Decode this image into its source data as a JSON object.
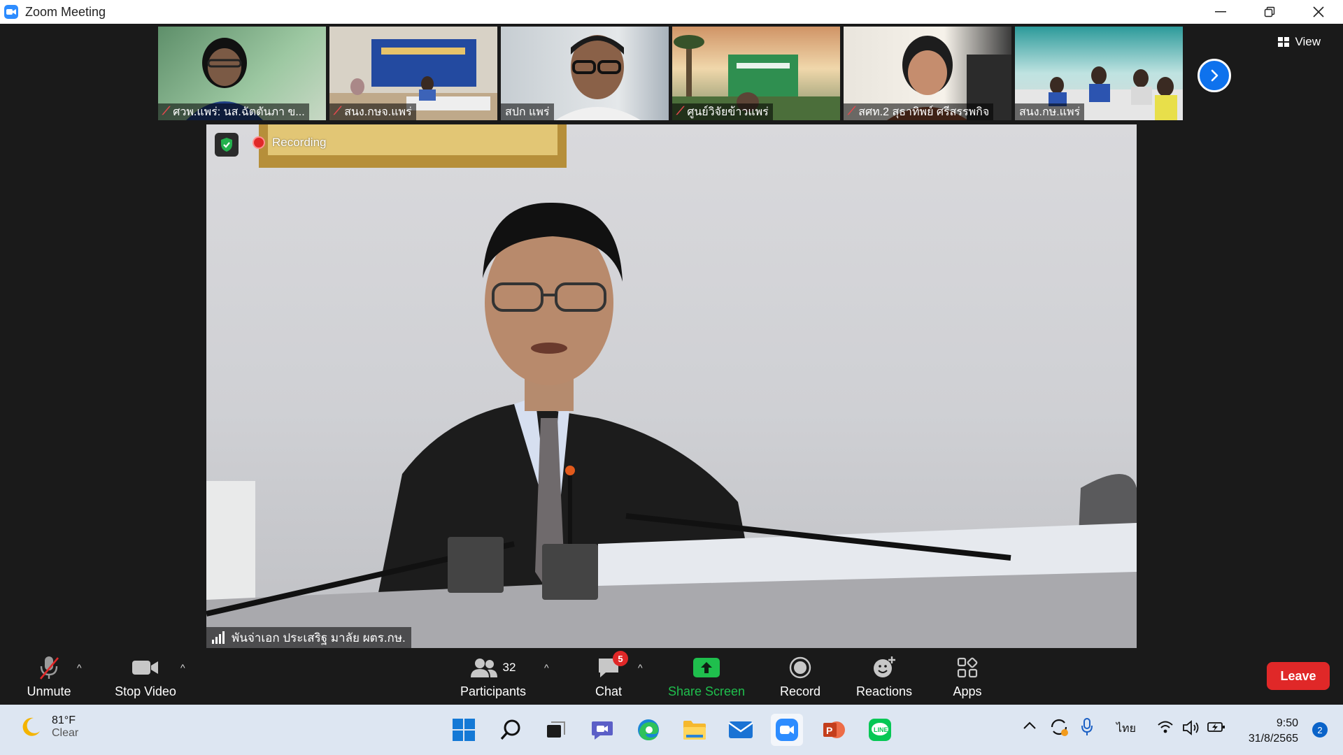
{
  "window": {
    "title": "Zoom Meeting"
  },
  "gallery": {
    "view_label": "View",
    "participants": [
      {
        "name": "ศวพ.แพร่: นส.ฉัตตันภา ข...",
        "muted": true
      },
      {
        "name": "สนง.กษจ.แพร่",
        "muted": true
      },
      {
        "name": "สปก แพร่",
        "muted": false
      },
      {
        "name": "ศูนย์วิจัยข้าวแพร่",
        "muted": true
      },
      {
        "name": "สศท.2 สุธาทิพย์ ศรีสรรพกิจ",
        "muted": true
      },
      {
        "name": "สนง.กษ.แพร่",
        "muted": false
      }
    ]
  },
  "main_video": {
    "recording_label": "Recording",
    "speaker_name": "พันจ่าเอก ประเสริฐ มาลัย ผตร.กษ."
  },
  "toolbar": {
    "unmute": "Unmute",
    "stop_video": "Stop Video",
    "participants": "Participants",
    "participants_count": "32",
    "chat": "Chat",
    "chat_badge": "5",
    "share_screen": "Share Screen",
    "record": "Record",
    "reactions": "Reactions",
    "apps": "Apps",
    "leave": "Leave"
  },
  "taskbar": {
    "weather_temp": "81°F",
    "weather_desc": "Clear",
    "language": "ไทย",
    "time": "9:50",
    "date": "31/8/2565",
    "notification_count": "2",
    "pinned": [
      "windows-start",
      "search",
      "task-view",
      "teams",
      "edge",
      "file-explorer",
      "mail",
      "zoom",
      "powerpoint",
      "line"
    ]
  },
  "colors": {
    "accent_blue": "#0e72ed",
    "share_green": "#1fbf4d",
    "leave_red": "#e02828",
    "taskbar_bg": "#dde6f2"
  }
}
